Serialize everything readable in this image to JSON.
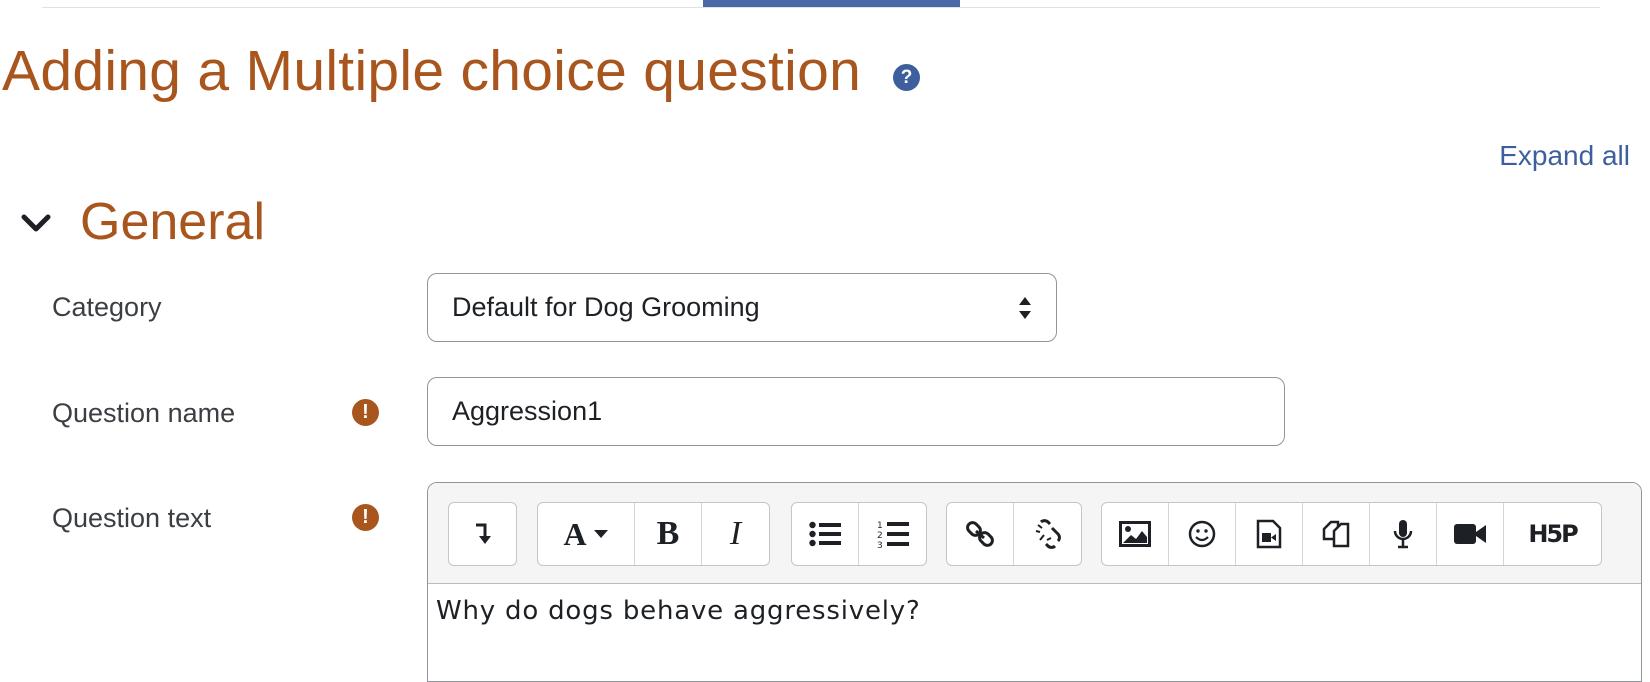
{
  "header": {
    "title": "Adding a Multiple choice question",
    "help_icon": "question-circle-icon",
    "expand_all": "Expand all"
  },
  "section": {
    "title": "General",
    "toggle_icon": "chevron-down-icon"
  },
  "form": {
    "category": {
      "label": "Category",
      "value": "Default for Dog Grooming"
    },
    "question_name": {
      "label": "Question name",
      "value": "Aggression1",
      "required_icon": "exclamation-circle-icon"
    },
    "question_text": {
      "label": "Question text",
      "required_icon": "exclamation-circle-icon",
      "content": "Why do dogs behave aggressively?"
    }
  },
  "editor": {
    "toolbar_groups": [
      [
        "toggle-toolbar-icon"
      ],
      [
        "font-style-icon",
        "bold-icon",
        "italic-icon"
      ],
      [
        "unordered-list-icon",
        "ordered-list-icon"
      ],
      [
        "link-icon",
        "unlink-icon"
      ],
      [
        "image-icon",
        "emoji-icon",
        "media-icon",
        "manage-files-icon",
        "record-audio-icon",
        "record-video-icon",
        "h5p-icon"
      ]
    ],
    "labels": {
      "font": "A",
      "bold": "B",
      "italic": "I",
      "h5p": "H5P"
    }
  },
  "colors": {
    "accent": "#a8561e",
    "link": "#3d5f9e"
  }
}
